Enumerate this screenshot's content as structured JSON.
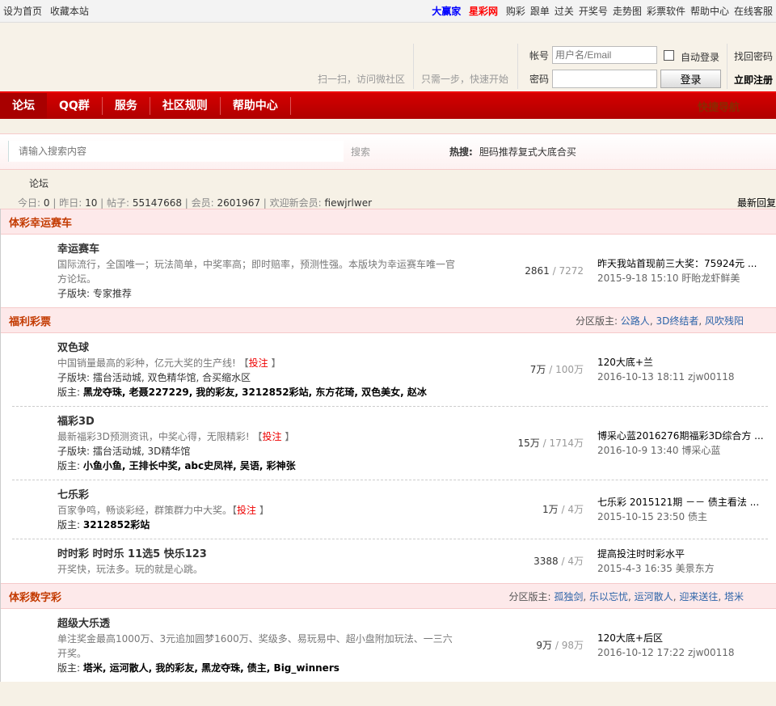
{
  "topbar": {
    "left": [
      "设为首页",
      "收藏本站"
    ],
    "brand1": "大赢家",
    "brand2": "星彩网",
    "links": [
      "购彩",
      "跟单",
      "过关",
      "开奖号",
      "走势图",
      "彩票软件",
      "帮助中心",
      "在线客服"
    ]
  },
  "header": {
    "scan": "扫一扫，访问微社区",
    "quick": "只需一步，快速开始",
    "account_label": "帐号",
    "account_placeholder": "用户名/Email",
    "password_label": "密码",
    "auto_login": "自动登录",
    "find_password": "找回密码",
    "login": "登录",
    "register": "立即注册"
  },
  "nav": {
    "items": [
      "论坛",
      "QQ群",
      "服务",
      "社区规则",
      "帮助中心"
    ],
    "quick": "快捷导航"
  },
  "search": {
    "placeholder": "请输入搜索内容",
    "button": "搜索",
    "hot_label": "热搜:",
    "hot": [
      "胆码",
      "推荐",
      "复式",
      "大底",
      "合买"
    ]
  },
  "breadcrumb": "论坛",
  "stats": {
    "today_l": "今日:",
    "today": "0",
    "yest_l": "昨日:",
    "yest": "10",
    "posts_l": "帖子:",
    "posts": "55147668",
    "members_l": "会员:",
    "members": "2601967",
    "welcome_l": "欢迎新会员:",
    "welcome": "fiewjrlwer",
    "latest": "最新回复"
  },
  "sections": [
    {
      "title": "体彩幸运赛车",
      "mods_label": "",
      "mods": [],
      "forums": [
        {
          "name": "幸运赛车",
          "desc": "国际流行，全国唯一；玩法简单，中奖率高；即时赔率，预测性强。本版块为幸运赛车唯一官方论坛。",
          "bet": "",
          "sub": "子版块: 专家推荐",
          "mods_label": "",
          "mods": "",
          "threads": "2861",
          "posts": "7272",
          "last_title": "昨天我站首现前三大奖：75924元 ...",
          "last_meta": "2015-9-18 15:10 盱眙龙虾鲜美"
        }
      ]
    },
    {
      "title": "福利彩票",
      "mods_label": "分区版主: ",
      "mods": [
        "公路人",
        "3D终结者",
        "风吹残阳"
      ],
      "forums": [
        {
          "name": "双色球",
          "desc": "中国销量最高的彩种，亿元大奖的生产线! 【",
          "bet": "投注",
          "sub": "子版块: 擂台活动城, 双色精华馆, 合买缩水区",
          "mods_label": "版主: ",
          "mods": "黑龙夺珠, 老聂227229, 我的彩友, 3212852彩站, 东方花琦, 双色美女, 赵冰",
          "threads": "7万",
          "posts": "100万",
          "last_title": "120大底+兰",
          "last_meta": "2016-10-13 18:11 zjw00118"
        },
        {
          "name": "福彩3D",
          "desc": "最新福彩3D预测资讯，中奖心得，无限精彩! 【",
          "bet": "投注",
          "sub": "子版块: 擂台活动城, 3D精华馆",
          "mods_label": "版主: ",
          "mods": "小鱼小鱼, 王排长中奖, abc史凤祥, 吴语, 彩神张",
          "threads": "15万",
          "posts": "1714万",
          "last_title": "博采心蓝2016276期福彩3D综合方 ...",
          "last_meta": "2016-10-9 13:40 博采心蓝"
        },
        {
          "name": "七乐彩",
          "desc": "百家争鸣，畅谈彩经，群策群力中大奖。【",
          "bet": "投注",
          "sub": "",
          "mods_label": "版主: ",
          "mods": "3212852彩站",
          "threads": "1万",
          "posts": "4万",
          "last_title": "七乐彩 2015121期 －－ 债主看法 ...",
          "last_meta": "2015-10-15 23:50 债主"
        },
        {
          "name": "时时彩  时时乐  11选5 快乐123",
          "desc": "开奖快，玩法多。玩的就是心跳。",
          "bet": "",
          "sub": "",
          "mods_label": "",
          "mods": "",
          "threads": "3388",
          "posts": "4万",
          "last_title": "提高投注时时彩水平",
          "last_meta": "2015-4-3 16:35 美景东方"
        }
      ]
    },
    {
      "title": "体彩数字彩",
      "mods_label": "分区版主: ",
      "mods": [
        "孤独剑",
        "乐以忘忧",
        "运河散人",
        "迎来送往",
        "塔米"
      ],
      "forums": [
        {
          "name": "超级大乐透",
          "desc": "单注奖金最高1000万、3元追加圆梦1600万、奖级多、易玩易中、超小盘附加玩法、一三六开奖。",
          "bet": "",
          "sub": "",
          "mods_label": "版主: ",
          "mods": "塔米, 运河散人, 我的彩友, 黑龙夺珠, 债主, Big_winners",
          "threads": "9万",
          "posts": "98万",
          "last_title": "120大底+后区",
          "last_meta": "2016-10-12 17:22 zjw00118"
        }
      ]
    }
  ]
}
